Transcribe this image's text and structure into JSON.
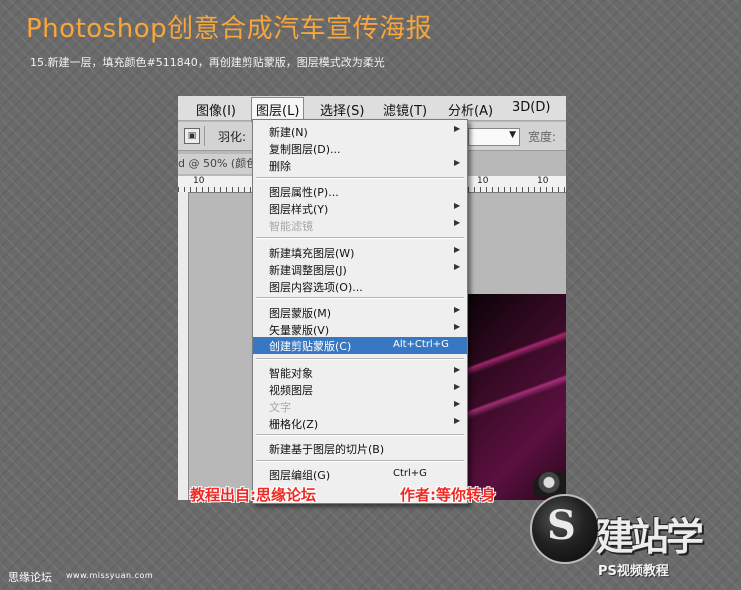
{
  "header": {
    "title": "Photoshop创意合成汽车宣传海报",
    "subtitle": "15.新建一层，填充颜色#511840，再创建剪贴蒙版，图层模式改为柔光"
  },
  "menubar": {
    "items": [
      "图像(I)",
      "图层(L)",
      "选择(S)",
      "滤镜(T)",
      "分析(A)",
      "3D(D)"
    ],
    "active": "图层(L)"
  },
  "options_bar": {
    "feather_label": "羽化:",
    "width_label": "宽度:"
  },
  "document": {
    "tab_label": "d @ 50% (颜色",
    "ruler_labels": [
      "10",
      "10",
      "10"
    ]
  },
  "layer_menu": {
    "items": [
      {
        "label": "新建(N)",
        "submenu": true
      },
      {
        "label": "复制图层(D)...",
        "submenu": false
      },
      {
        "label": "删除",
        "submenu": true
      },
      {
        "label": "图层属性(P)...",
        "submenu": false
      },
      {
        "label": "图层样式(Y)",
        "submenu": true
      },
      {
        "label": "智能滤镜",
        "submenu": true,
        "disabled": true
      },
      {
        "label": "新建填充图层(W)",
        "submenu": true
      },
      {
        "label": "新建调整图层(J)",
        "submenu": true
      },
      {
        "label": "图层内容选项(O)...",
        "submenu": false
      },
      {
        "label": "图层蒙版(M)",
        "submenu": true
      },
      {
        "label": "矢量蒙版(V)",
        "submenu": true
      },
      {
        "label": "创建剪贴蒙版(C)",
        "submenu": false,
        "shortcut": "Alt+Ctrl+G",
        "highlighted": true
      },
      {
        "label": "智能对象",
        "submenu": true
      },
      {
        "label": "视频图层",
        "submenu": true
      },
      {
        "label": "文字",
        "submenu": true,
        "disabled": true
      },
      {
        "label": "栅格化(Z)",
        "submenu": true
      },
      {
        "label": "新建基于图层的切片(B)",
        "submenu": false
      },
      {
        "label": "图层编组(G)",
        "submenu": false,
        "shortcut": "Ctrl+G"
      }
    ]
  },
  "credits": {
    "source": "教程出自:思缘论坛",
    "author": "作者:等你转身"
  },
  "watermark": {
    "logo_text": "建站学",
    "sub_text": "PS视频教程"
  },
  "footer": {
    "forum": "思缘论坛",
    "url": "www.missyuan.com"
  },
  "colors": {
    "title": "#f7a53c",
    "highlight": "#3878c2",
    "credit_red": "#ee2a24",
    "fill_color": "#511840"
  }
}
